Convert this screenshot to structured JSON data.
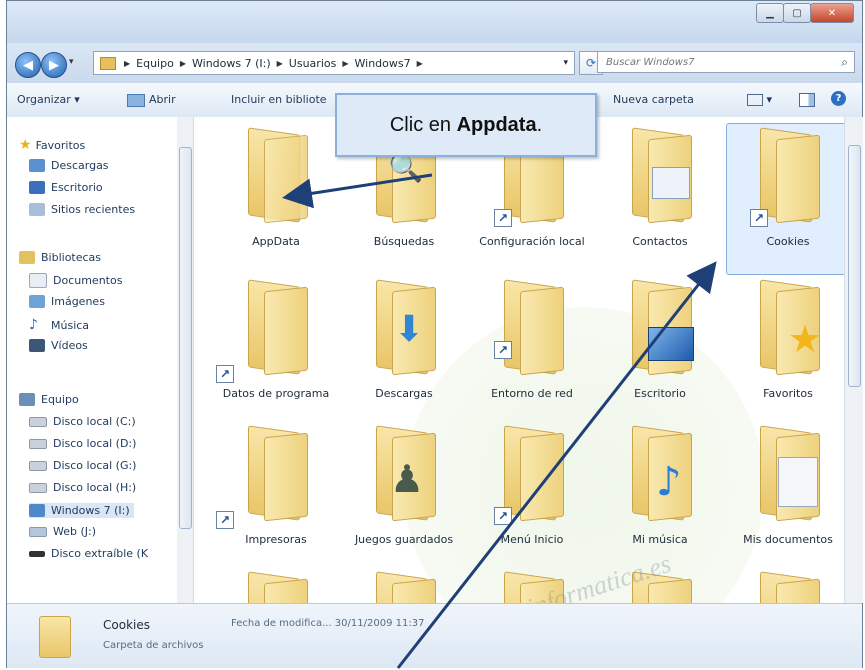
{
  "address": {
    "crumbs": [
      "Equipo",
      "Windows 7 (I:)",
      "Usuarios",
      "Windows7"
    ],
    "search_placeholder": "Buscar Windows7"
  },
  "toolbar": {
    "organize": "Organizar ▾",
    "open": "Abrir",
    "include": "Incluir en bibliote",
    "new_folder": "Nueva carpeta"
  },
  "sidebar": {
    "favorites": "Favoritos",
    "fav_items": [
      "Descargas",
      "Escritorio",
      "Sitios recientes"
    ],
    "libraries": "Bibliotecas",
    "lib_items": [
      "Documentos",
      "Imágenes",
      "Música",
      "Vídeos"
    ],
    "computer": "Equipo",
    "drives": [
      "Disco local (C:)",
      "Disco local (D:)",
      "Disco local (G:)",
      "Disco local (H:)",
      "Windows 7 (I:)",
      "Web (J:)",
      "Disco extraíble (K"
    ]
  },
  "folders": [
    {
      "label": "AppData",
      "shortcut": false
    },
    {
      "label": "Búsquedas",
      "shortcut": false
    },
    {
      "label": "Configuración local",
      "shortcut": true
    },
    {
      "label": "Contactos",
      "shortcut": false
    },
    {
      "label": "Cookies",
      "shortcut": true,
      "selected": true
    },
    {
      "label": "Datos de programa",
      "shortcut": true
    },
    {
      "label": "Descargas",
      "shortcut": false
    },
    {
      "label": "Entorno de red",
      "shortcut": true
    },
    {
      "label": "Escritorio",
      "shortcut": false
    },
    {
      "label": "Favoritos",
      "shortcut": false
    },
    {
      "label": "Impresoras",
      "shortcut": true
    },
    {
      "label": "Juegos guardados",
      "shortcut": false
    },
    {
      "label": "Menú Inicio",
      "shortcut": true
    },
    {
      "label": "Mi música",
      "shortcut": false
    },
    {
      "label": "Mis documentos",
      "shortcut": false
    }
  ],
  "status": {
    "name": "Cookies",
    "type": "Carpeta de archivos",
    "modified": "Fecha de modifica... 30/11/2009 11:37"
  },
  "callout": {
    "prefix": "Clic en ",
    "bold": "Appdata",
    "suffix": "."
  },
  "watermark": "www.aulainformatica.es"
}
